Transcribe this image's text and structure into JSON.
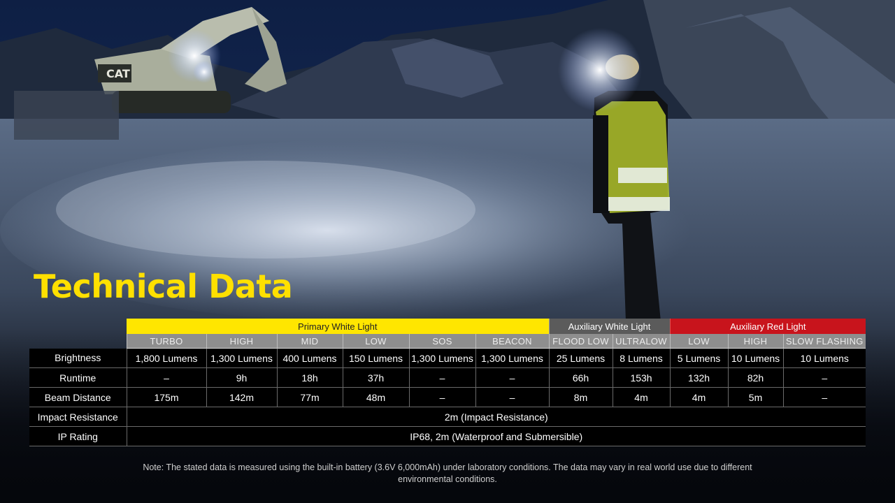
{
  "title": "Technical Data",
  "scene": {
    "vehicle_brand": "CAT",
    "colors": {
      "sky": "#0b1a3a",
      "ground": "#6e7e96",
      "vest": "#b6c72a",
      "accent_yellow": "#ffe000",
      "accent_red": "#c8141c"
    }
  },
  "table": {
    "groups": [
      {
        "label": "Primary White Light",
        "span": 6,
        "color": "#ffe600"
      },
      {
        "label": "Auxiliary White Light",
        "span": 2,
        "color": "#5b5b5b"
      },
      {
        "label": "Auxiliary Red Light",
        "span": 3,
        "color": "#c8141c"
      }
    ],
    "modes": [
      "TURBO",
      "HIGH",
      "MID",
      "LOW",
      "SOS",
      "BEACON",
      "FLOOD LOW",
      "ULTRALOW",
      "LOW",
      "HIGH",
      "SLOW FLASHING"
    ],
    "rows": [
      {
        "label": "Brightness",
        "values": [
          "1,800 Lumens",
          "1,300 Lumens",
          "400 Lumens",
          "150 Lumens",
          "1,300 Lumens",
          "1,300 Lumens",
          "25 Lumens",
          "8 Lumens",
          "5 Lumens",
          "10 Lumens",
          "10 Lumens"
        ]
      },
      {
        "label": "Runtime",
        "values": [
          "–",
          "9h",
          "18h",
          "37h",
          "–",
          "–",
          "66h",
          "153h",
          "132h",
          "82h",
          "–"
        ]
      },
      {
        "label": "Beam Distance",
        "values": [
          "175m",
          "142m",
          "77m",
          "48m",
          "–",
          "–",
          "8m",
          "4m",
          "4m",
          "5m",
          "–"
        ]
      },
      {
        "label": "Impact Resistance",
        "full": "2m (Impact Resistance)"
      },
      {
        "label": "IP Rating",
        "full": "IP68, 2m (Waterproof and Submersible)"
      }
    ]
  },
  "note": "Note: The stated data is measured using the built-in battery (3.6V 6,000mAh) under laboratory conditions. The data may vary in real world use due to different environmental conditions."
}
